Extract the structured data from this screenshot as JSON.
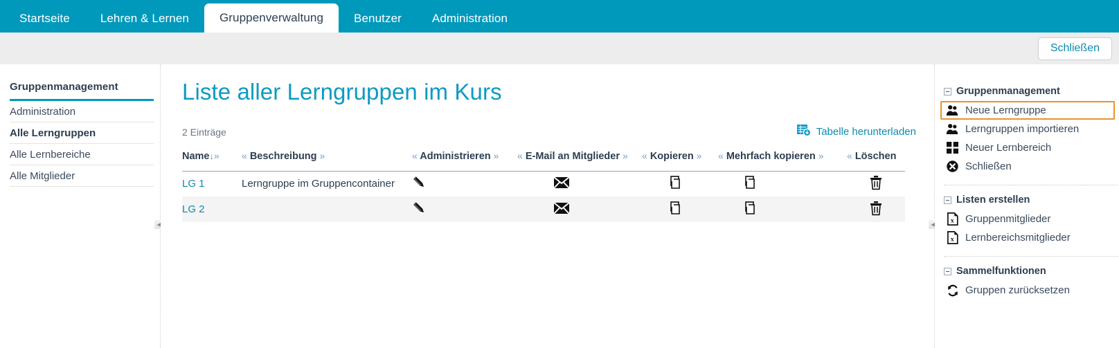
{
  "topnav": {
    "tabs": [
      {
        "label": "Startseite",
        "active": false
      },
      {
        "label": "Lehren & Lernen",
        "active": false
      },
      {
        "label": "Gruppenverwaltung",
        "active": true
      },
      {
        "label": "Benutzer",
        "active": false
      },
      {
        "label": "Administration",
        "active": false
      }
    ]
  },
  "toolbar": {
    "close_label": "Schließen"
  },
  "left_sidebar": {
    "title": "Gruppenmanagement",
    "items": [
      {
        "label": "Administration",
        "selected": false
      },
      {
        "label": "Alle Lerngruppen",
        "selected": true
      },
      {
        "label": "Alle Lernbereiche",
        "selected": false
      },
      {
        "label": "Alle Mitglieder",
        "selected": false
      }
    ]
  },
  "main": {
    "page_title": "Liste aller Lerngruppen im Kurs",
    "entry_count": "2 Einträge",
    "download_label": "Tabelle herunterladen",
    "download_icon": "table-download-icon",
    "table": {
      "headers": [
        {
          "label": "Name",
          "sort": "↓",
          "pre": "",
          "post": "»"
        },
        {
          "label": "Beschreibung",
          "sort": "",
          "pre": "«",
          "post": "»"
        },
        {
          "label": "Administrieren",
          "sort": "",
          "pre": "«",
          "post": "»"
        },
        {
          "label": "E-Mail an Mitglieder",
          "sort": "",
          "pre": "«",
          "post": "»"
        },
        {
          "label": "Kopieren",
          "sort": "",
          "pre": "«",
          "post": "»"
        },
        {
          "label": "Mehrfach kopieren",
          "sort": "",
          "pre": "«",
          "post": "»"
        },
        {
          "label": "Löschen",
          "sort": "",
          "pre": "«",
          "post": ""
        }
      ],
      "rows": [
        {
          "name": "LG 1",
          "description": "Lerngruppe im Gruppencontainer",
          "administrieren_icon": "pencil-icon",
          "email_icon": "envelope-icon",
          "kopieren_icon": "copy-icon",
          "mehrfach_kopieren_icon": "copy-icon",
          "loeschen_icon": "trash-icon"
        },
        {
          "name": "LG 2",
          "description": "",
          "administrieren_icon": "pencil-icon",
          "email_icon": "envelope-icon",
          "kopieren_icon": "copy-icon",
          "mehrfach_kopieren_icon": "copy-icon",
          "loeschen_icon": "trash-icon"
        }
      ]
    }
  },
  "right_sidebar": {
    "groups": [
      {
        "title": "Gruppenmanagement",
        "items": [
          {
            "label": "Neue Lerngruppe",
            "icon": "users-add-icon",
            "highlight": true
          },
          {
            "label": "Lerngruppen importieren",
            "icon": "users-add-icon",
            "highlight": false
          },
          {
            "label": "Neuer Lernbereich",
            "icon": "grid-squares-icon",
            "highlight": false
          },
          {
            "label": "Schließen",
            "icon": "close-circle-icon",
            "highlight": false
          }
        ]
      },
      {
        "title": "Listen erstellen",
        "items": [
          {
            "label": "Gruppenmitglieder",
            "icon": "excel-file-icon",
            "highlight": false
          },
          {
            "label": "Lernbereichsmitglieder",
            "icon": "excel-file-icon",
            "highlight": false
          }
        ]
      },
      {
        "title": "Sammelfunktionen",
        "items": [
          {
            "label": "Gruppen zurücksetzen",
            "icon": "refresh-icon",
            "highlight": false
          }
        ]
      }
    ]
  },
  "colors": {
    "brand_teal": "#0099bb",
    "link_teal": "#0d8bb0",
    "title_teal": "#0d9ac2",
    "toolbar_gray": "#ededed",
    "highlight_orange": "#e8922f",
    "row_alt": "#f4f4f4",
    "text_dark": "#2d3e50"
  }
}
